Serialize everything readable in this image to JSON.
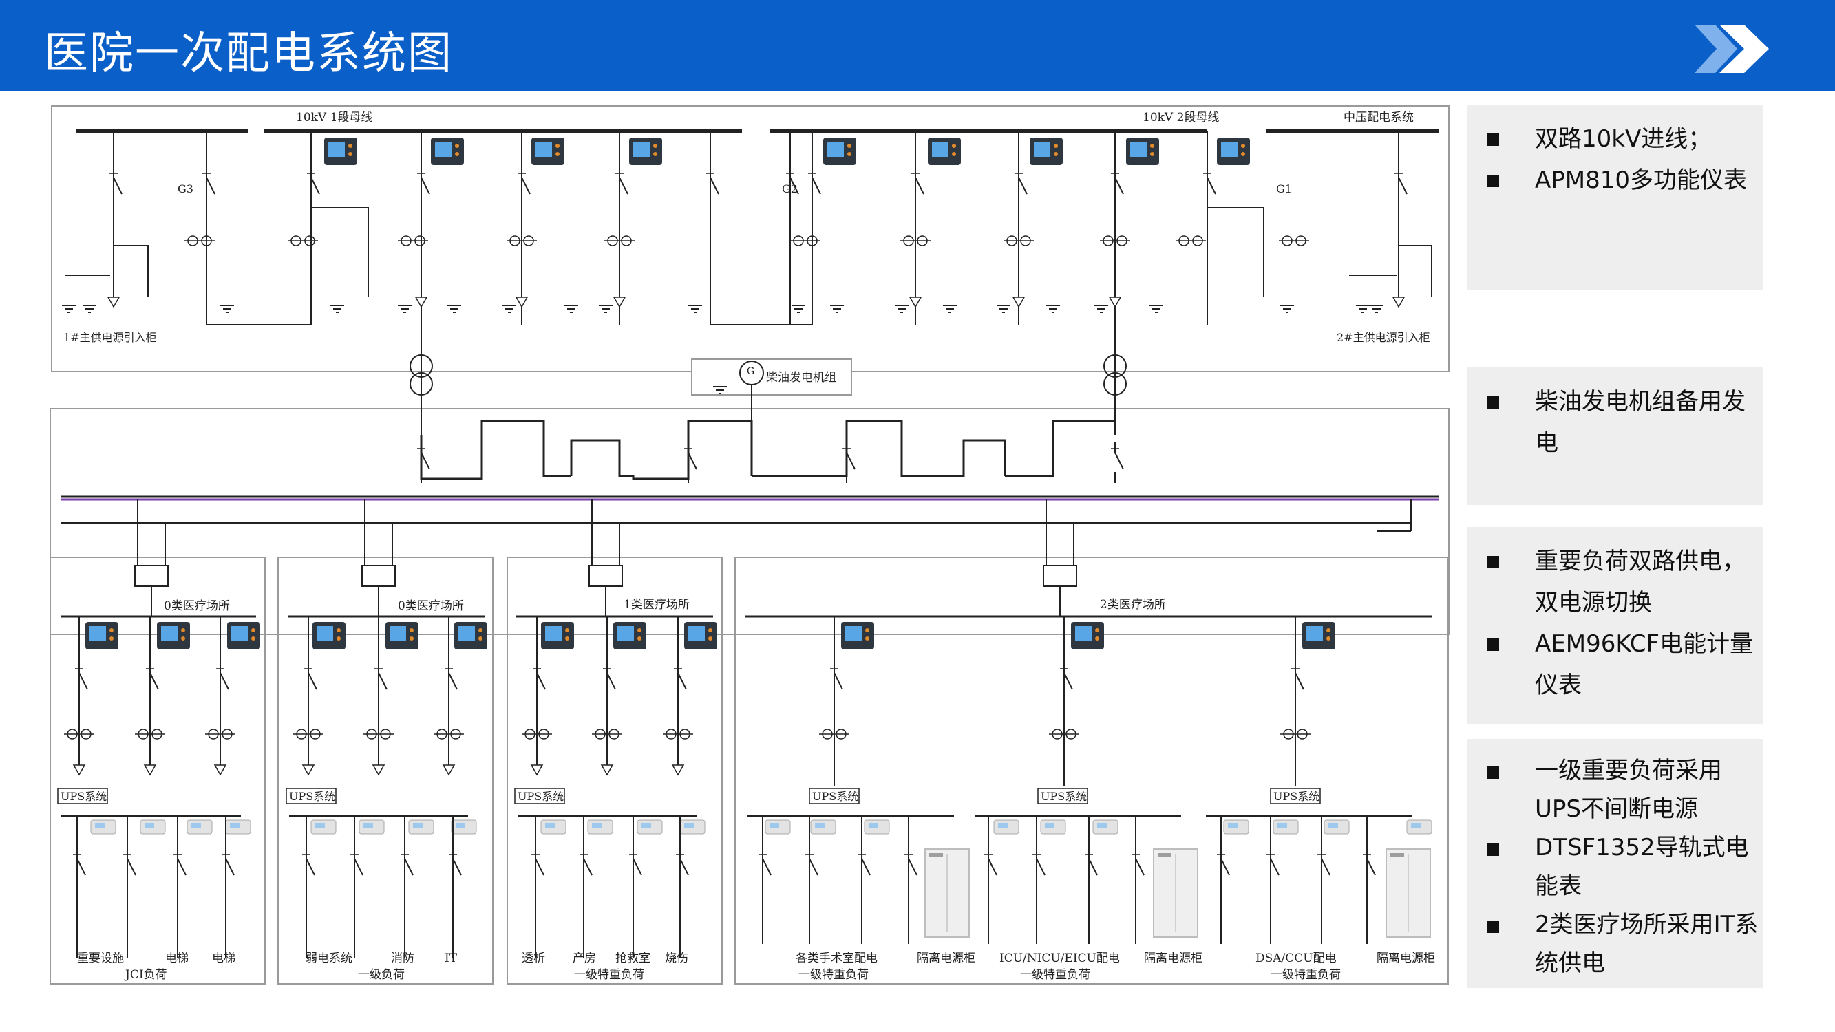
{
  "header": {
    "title": "医院一次配电系统图",
    "background": "#0b5fc8"
  },
  "diagram": {
    "bus_10kv_1": "10kV 1段母线",
    "bus_10kv_2": "10kV 2段母线",
    "mv_system": "中压配电系统",
    "g3": "G3",
    "g2": "G2",
    "g1": "G1",
    "incoming_1": "1#主供电源引入柜",
    "incoming_2": "2#主供电源引入柜",
    "generator_symbol": "G",
    "generator_label": "柴油发电机组",
    "sections": [
      {
        "title": "0类医疗场所",
        "ups": "UPS系统",
        "loads": [
          "重要设施",
          "电梯",
          "电梯"
        ],
        "category": "JCI负荷"
      },
      {
        "title": "0类医疗场所",
        "ups": "UPS系统",
        "loads": [
          "弱电系统",
          "消防",
          "IT"
        ],
        "category": "一级负荷"
      },
      {
        "title": "1类医疗场所",
        "ups": "UPS系统",
        "loads": [
          "透析",
          "产房",
          "抢救室",
          "烧伤"
        ],
        "category": "一级特重负荷"
      },
      {
        "title": "2类医疗场所",
        "ups": "UPS系统",
        "groups": [
          {
            "load": "各类手术室配电",
            "cabinet": "隔离电源柜",
            "category": "一级特重负荷"
          },
          {
            "load": "ICU/NICU/EICU配电",
            "cabinet": "隔离电源柜",
            "category": "一级特重负荷"
          },
          {
            "load": "DSA/CCU配电",
            "cabinet": "隔离电源柜",
            "category": "一级特重负荷"
          }
        ]
      }
    ]
  },
  "panels": [
    {
      "bullets": [
        "双路10kV进线；",
        "APM810多功能仪表"
      ]
    },
    {
      "bullets": [
        "柴油发电机组备用发电"
      ]
    },
    {
      "bullets": [
        "重要负荷双路供电，双电源切换",
        "AEM96KCF电能计量仪表"
      ]
    },
    {
      "bullets": [
        "一级重要负荷采用UPS不间断电源",
        "DTSF1352导轨式电能表",
        "2类医疗场所采用IT系统供电"
      ]
    }
  ]
}
